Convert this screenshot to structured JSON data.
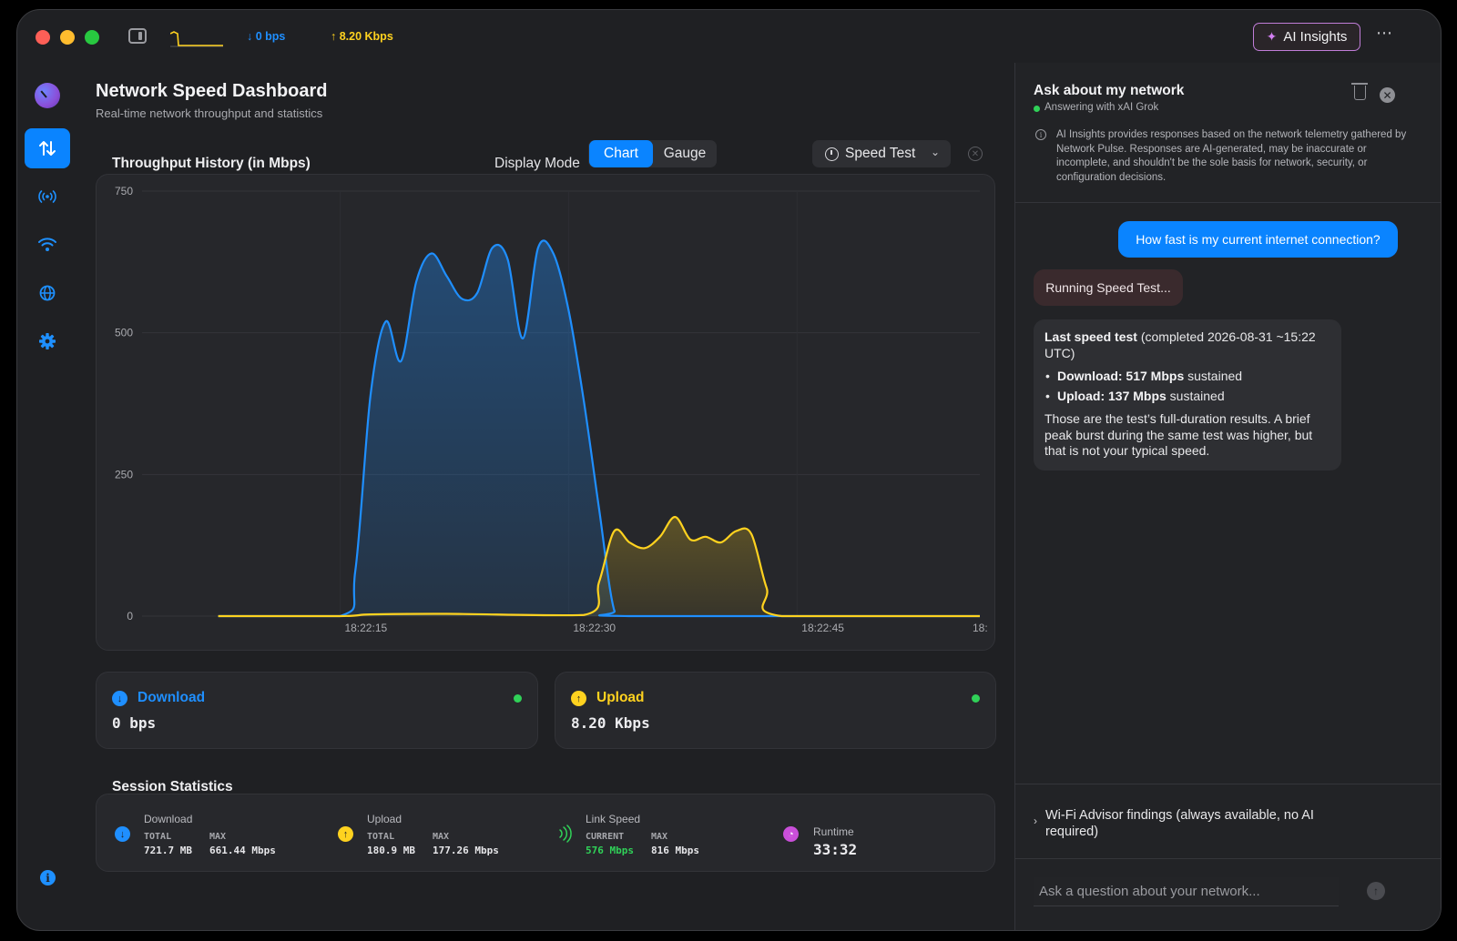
{
  "titlebar": {
    "down_rate": "↓ 0 bps",
    "up_rate": "↑ 8.20 Kbps",
    "ai_button": "AI Insights",
    "more": "⋯"
  },
  "header": {
    "title": "Network Speed Dashboard",
    "subtitle": "Real-time network throughput and statistics"
  },
  "toolbar": {
    "chart_title": "Throughput History (in Mbps)",
    "display_mode_label": "Display Mode",
    "mode_chart": "Chart",
    "mode_gauge": "Gauge",
    "speed_test": "Speed Test"
  },
  "chart_data": {
    "type": "area",
    "xlabel": "",
    "ylabel": "",
    "ylim": [
      0,
      750
    ],
    "yticks": [
      0,
      250,
      500,
      750
    ],
    "xticks": [
      "18:22:15",
      "18:22:30",
      "18:22:45",
      "18:"
    ],
    "grid": true,
    "series": [
      {
        "color": "#1f8fff",
        "points": [
          [
            5,
            0
          ],
          [
            13,
            0
          ],
          [
            14,
            80
          ],
          [
            15,
            390
          ],
          [
            16,
            520
          ],
          [
            17,
            450
          ],
          [
            18,
            590
          ],
          [
            19,
            640
          ],
          [
            20,
            600
          ],
          [
            21,
            560
          ],
          [
            22,
            570
          ],
          [
            23,
            650
          ],
          [
            24,
            630
          ],
          [
            25,
            490
          ],
          [
            26,
            650
          ],
          [
            27,
            640
          ],
          [
            28,
            540
          ],
          [
            29,
            380
          ],
          [
            30,
            190
          ],
          [
            31,
            10
          ],
          [
            32,
            0
          ],
          [
            55,
            0
          ]
        ]
      },
      {
        "color": "#ffd21f",
        "points": [
          [
            5,
            0
          ],
          [
            13,
            0
          ],
          [
            15,
            3
          ],
          [
            20,
            4
          ],
          [
            29,
            2
          ],
          [
            30,
            60
          ],
          [
            31,
            150
          ],
          [
            32,
            130
          ],
          [
            33,
            120
          ],
          [
            34,
            140
          ],
          [
            35,
            175
          ],
          [
            36,
            135
          ],
          [
            37,
            140
          ],
          [
            38,
            130
          ],
          [
            39,
            150
          ],
          [
            40,
            145
          ],
          [
            41,
            50
          ],
          [
            42,
            0
          ],
          [
            55,
            0
          ]
        ]
      }
    ]
  },
  "metrics": {
    "download": {
      "label": "Download",
      "value": "0 bps",
      "color": "#1f8fff"
    },
    "upload": {
      "label": "Upload",
      "value": "8.20 Kbps",
      "color": "#ffd21f"
    }
  },
  "session": {
    "title": "Session Statistics",
    "download": {
      "label": "Download",
      "total_label": "TOTAL",
      "total": "721.7 MB",
      "max_label": "MAX",
      "max": "661.44 Mbps"
    },
    "upload": {
      "label": "Upload",
      "total_label": "TOTAL",
      "total": "180.9 MB",
      "max_label": "MAX",
      "max": "177.26 Mbps"
    },
    "link": {
      "label": "Link Speed",
      "current_label": "CURRENT",
      "current": "576 Mbps",
      "max_label": "MAX",
      "max": "816 Mbps"
    },
    "runtime": {
      "label": "Runtime",
      "value": "33:32"
    }
  },
  "panel": {
    "title": "Ask about my network",
    "subtitle": "Answering with xAI Grok",
    "disclaimer": "AI Insights provides responses based on the network telemetry gathered by Network Pulse. Responses are AI-generated, may be inaccurate or incomplete, and shouldn't be the sole basis for network, security, or configuration decisions.",
    "user_question": "How fast is my current internet connection?",
    "status_message": "Running Speed Test...",
    "answer": {
      "heading_bold": "Last speed test",
      "heading_rest": " (completed 2026-08-31 ~15:22 UTC)",
      "bullets": [
        {
          "bold": "Download: 517 Mbps",
          "rest": " sustained"
        },
        {
          "bold": "Upload: 137 Mbps",
          "rest": " sustained"
        }
      ],
      "summary": "Those are the test’s full-duration results. A brief peak burst during the same test was higher, but that is not your typical speed."
    },
    "wifi_advisor": "Wi-Fi Advisor findings (always available, no AI required)",
    "input_placeholder": "Ask a question about your network..."
  },
  "icons": {
    "nav": [
      "app-logo-icon",
      "transfer-arrows-icon",
      "antenna-icon",
      "wifi-icon",
      "globe-icon",
      "gear-icon",
      "info-icon"
    ]
  }
}
